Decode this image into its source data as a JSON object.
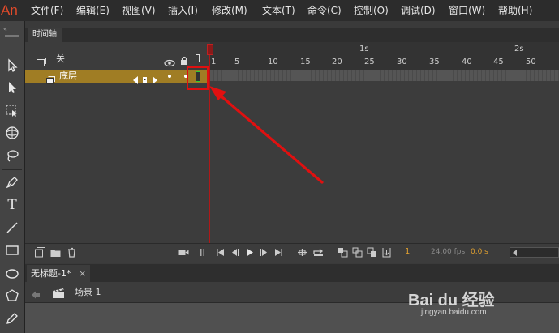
{
  "app": {
    "logo": "An"
  },
  "menubar": {
    "items": [
      "文件(F)",
      "编辑(E)",
      "视图(V)",
      "插入(I)",
      "修改(M)",
      "文本(T)",
      "命令(C)",
      "控制(O)",
      "调试(D)",
      "窗口(W)",
      "帮助(H)"
    ]
  },
  "timeline": {
    "tab_label": "时间轴",
    "header_label": "关",
    "layer_name": "底层",
    "ruler_numbers": [
      "1",
      "5",
      "10",
      "15",
      "20",
      "25",
      "30",
      "35",
      "40",
      "45",
      "50"
    ],
    "ruler_seconds": [
      "1s",
      "2s"
    ],
    "current_frame": "1",
    "fps": "24.00 fps",
    "elapsed": "0.0 s"
  },
  "document": {
    "tab_label": "无标题-1*",
    "close_label": "×",
    "scene_label": "场景 1"
  },
  "watermark": {
    "logo": "Bai du 经验",
    "url": "jingyan.baidu.com"
  },
  "colors": {
    "layer_highlight": "#a07d24",
    "playhead": "#b01818",
    "annotation": "#e01010",
    "keyframe": "#2fd22f"
  },
  "icons": [
    "selection-icon",
    "subselect-icon",
    "free-transform-icon",
    "3d-rotate-icon",
    "lasso-icon",
    "pen-icon",
    "text-tool-icon",
    "line-icon",
    "rectangle-icon",
    "oval-icon",
    "polystar-icon",
    "pencil-icon"
  ]
}
